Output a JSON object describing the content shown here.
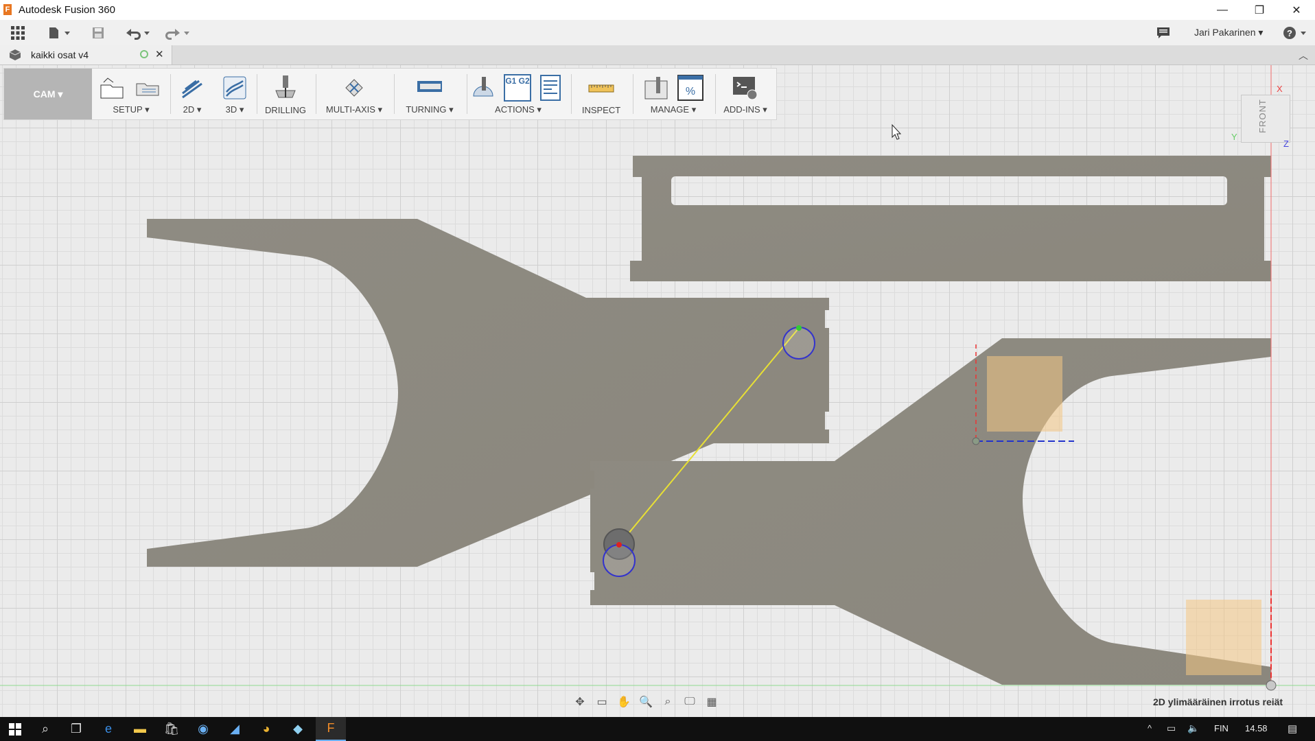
{
  "window": {
    "title": "Autodesk Fusion 360",
    "app_icon_letter": "F",
    "minimize": "—",
    "restore": "❐",
    "close": "✕"
  },
  "quick_access": {
    "user": "Jari Pakarinen ▾",
    "help": "?"
  },
  "document_tab": {
    "label": "kaikki osat v4",
    "close": "✕"
  },
  "toolbar": {
    "workspace": "CAM ▾",
    "groups": [
      {
        "label": "SETUP ▾"
      },
      {
        "label": "2D ▾"
      },
      {
        "label": "3D ▾"
      },
      {
        "label": "DRILLING"
      },
      {
        "label": "MULTI-AXIS ▾"
      },
      {
        "label": "TURNING ▾"
      },
      {
        "label": "ACTIONS ▾"
      },
      {
        "label": "INSPECT"
      },
      {
        "label": "MANAGE ▾"
      },
      {
        "label": "ADD-INS ▾"
      }
    ],
    "actions_icon_text": "G1 G2"
  },
  "viewcube": {
    "face": "FRONT",
    "axis_x": "X",
    "axis_y": "Y",
    "axis_z": "Z"
  },
  "status": {
    "operation": "2D ylimääräinen irrotus reiät"
  },
  "taskbar": {
    "language": "FIN",
    "time": "14.58"
  },
  "colors": {
    "part": "#8e8a80",
    "stock_highlight": "#f4c784",
    "toolpath": "#e8e034",
    "circle": "#3333cc",
    "accent": "#6ab0f3"
  }
}
